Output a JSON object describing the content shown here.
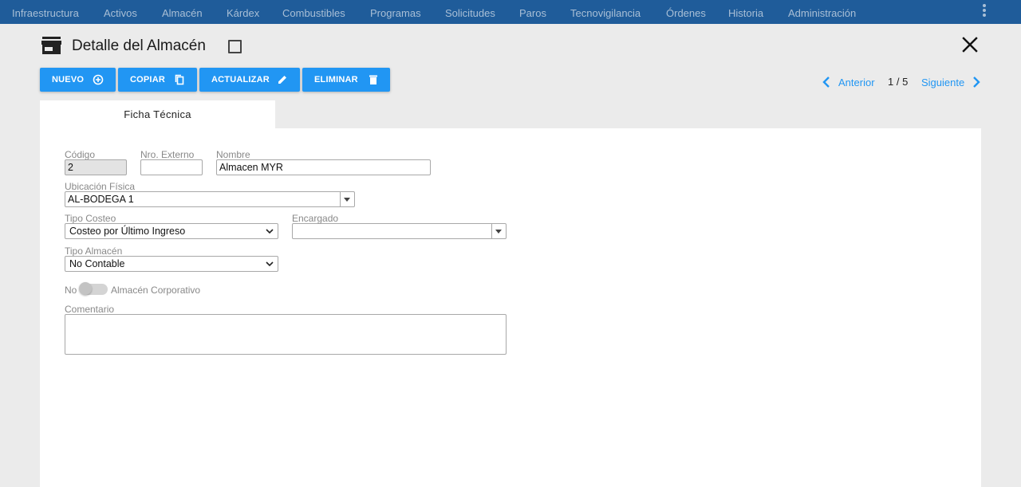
{
  "nav": {
    "items": [
      "Infraestructura",
      "Activos",
      "Almacén",
      "Kárdex",
      "Combustibles",
      "Programas",
      "Solicitudes",
      "Paros",
      "Tecnovigilancia",
      "Órdenes",
      "Historia",
      "Administración"
    ]
  },
  "header": {
    "title": "Detalle del Almacén"
  },
  "toolbar": {
    "nuevo": "NUEVO",
    "copiar": "COPIAR",
    "actualizar": "ACTUALIZAR",
    "eliminar": "ELIMINAR"
  },
  "pager": {
    "prev": "Anterior",
    "position": "1 / 5",
    "next": "Siguiente"
  },
  "tabs": [
    {
      "label": "Ficha Técnica"
    }
  ],
  "form": {
    "codigo": {
      "label": "Código",
      "value": "2"
    },
    "nro_externo": {
      "label": "Nro. Externo",
      "value": ""
    },
    "nombre": {
      "label": "Nombre",
      "value": "Almacen MYR"
    },
    "ubicacion": {
      "label": "Ubicación Física",
      "value": "AL-BODEGA 1"
    },
    "tipo_costeo": {
      "label": "Tipo Costeo",
      "value": "Costeo por Último Ingreso"
    },
    "encargado": {
      "label": "Encargado",
      "value": ""
    },
    "tipo_almacen": {
      "label": "Tipo Almacén",
      "value": "No Contable"
    },
    "corporativo": {
      "state_text": "No",
      "label": "Almacén Corporativo"
    },
    "comentario": {
      "label": "Comentario",
      "value": ""
    }
  },
  "colors": {
    "nav_bg": "#1f5c9a",
    "nav_text": "#a9bfd6",
    "accent": "#2196f3",
    "page_bg": "#ebebeb"
  }
}
